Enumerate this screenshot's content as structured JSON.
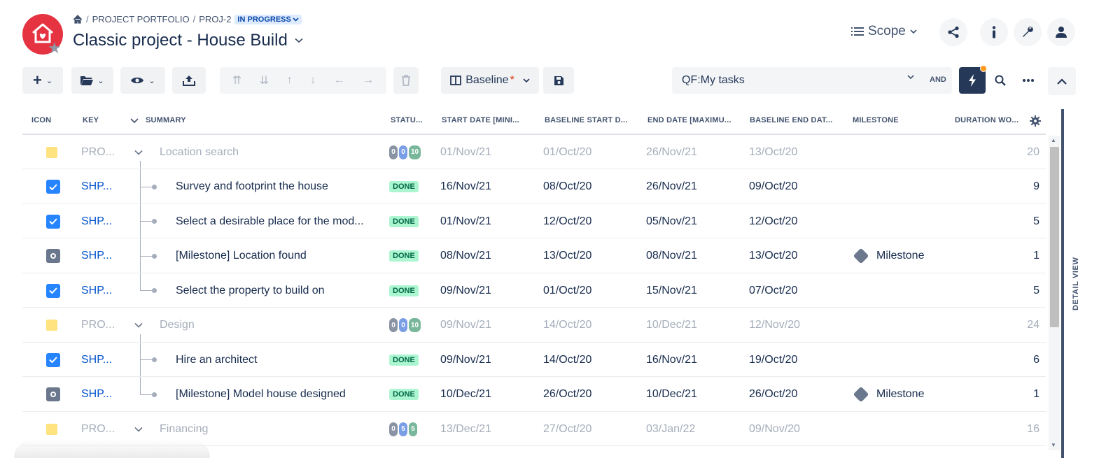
{
  "breadcrumb": {
    "items": [
      "PROJECT PORTFOLIO",
      "PROJ-2"
    ],
    "status": "IN PROGRESS"
  },
  "header": {
    "title": "Classic project - House Build",
    "scope_label": "Scope"
  },
  "toolbar": {
    "baseline_label": "Baseline",
    "baseline_modified_marker": "*",
    "quick_filter_label": "QF:My tasks",
    "and_label": "AND"
  },
  "columns": [
    "ICON",
    "KEY",
    "SUMMARY",
    "STATU...",
    "START DATE [MINI...",
    "BASELINE START D...",
    "END DATE [MAXIMU...",
    "BASELINE END DAT...",
    "MILESTONE",
    "DURATION WO..."
  ],
  "rows": [
    {
      "type": "parent",
      "icon": "note-icon",
      "key": "PRO...",
      "summary": "Location search",
      "progress": [
        "0",
        "0",
        "10"
      ],
      "start": "01/Nov/21",
      "baseline_start": "01/Oct/20",
      "end": "26/Nov/21",
      "baseline_end": "13/Oct/20",
      "milestone": "",
      "duration": "20"
    },
    {
      "type": "child",
      "icon": "checkbox-icon",
      "key": "SHP...",
      "summary": "Survey and footprint the house",
      "status": "DONE",
      "start": "16/Nov/21",
      "baseline_start": "08/Oct/20",
      "end": "26/Nov/21",
      "baseline_end": "09/Oct/20",
      "milestone": "",
      "duration": "9"
    },
    {
      "type": "child",
      "icon": "checkbox-icon",
      "key": "SHP...",
      "summary": "Select a desirable place for the mod...",
      "status": "DONE",
      "start": "01/Nov/21",
      "baseline_start": "12/Oct/20",
      "end": "05/Nov/21",
      "baseline_end": "12/Oct/20",
      "milestone": "",
      "duration": "5"
    },
    {
      "type": "child",
      "icon": "milestone-icon",
      "key": "SHP...",
      "summary": "[Milestone] Location found",
      "status": "DONE",
      "start": "08/Nov/21",
      "baseline_start": "13/Oct/20",
      "end": "08/Nov/21",
      "baseline_end": "13/Oct/20",
      "milestone": "Milestone",
      "duration": "1"
    },
    {
      "type": "child",
      "icon": "checkbox-icon",
      "key": "SHP...",
      "summary": "Select the property to build on",
      "status": "DONE",
      "start": "09/Nov/21",
      "baseline_start": "01/Oct/20",
      "end": "15/Nov/21",
      "baseline_end": "07/Oct/20",
      "milestone": "",
      "duration": "5"
    },
    {
      "type": "parent",
      "icon": "note-icon",
      "key": "PRO...",
      "summary": "Design",
      "progress": [
        "0",
        "0",
        "10"
      ],
      "start": "09/Nov/21",
      "baseline_start": "14/Oct/20",
      "end": "10/Dec/21",
      "baseline_end": "12/Nov/20",
      "milestone": "",
      "duration": "24"
    },
    {
      "type": "child",
      "icon": "checkbox-icon",
      "key": "SHP...",
      "summary": "Hire an architect",
      "status": "DONE",
      "start": "09/Nov/21",
      "baseline_start": "14/Oct/20",
      "end": "16/Nov/21",
      "baseline_end": "19/Oct/20",
      "milestone": "",
      "duration": "6"
    },
    {
      "type": "child",
      "icon": "milestone-icon",
      "key": "SHP...",
      "summary": "[Milestone] Model house designed",
      "status": "DONE",
      "start": "10/Dec/21",
      "baseline_start": "26/Oct/20",
      "end": "10/Dec/21",
      "baseline_end": "26/Oct/20",
      "milestone": "Milestone",
      "duration": "1"
    },
    {
      "type": "parent",
      "icon": "note-icon",
      "key": "PRO...",
      "summary": "Financing",
      "progress": [
        "0",
        "5",
        "5"
      ],
      "start": "13/Dec/21",
      "baseline_start": "27/Oct/20",
      "end": "03/Jan/22",
      "baseline_end": "09/Nov/20",
      "milestone": "",
      "duration": "16"
    }
  ],
  "detail_view_label": "DETAIL VIEW",
  "colors": {
    "logo": "#e53341",
    "accent_blue": "#0052cc",
    "checkbox": "#2684ff",
    "done_bg": "#abf5d1",
    "done_text": "#006644",
    "note": "#ffe380",
    "toolbar_active": "#253858",
    "notification_dot": "#ff991f"
  }
}
